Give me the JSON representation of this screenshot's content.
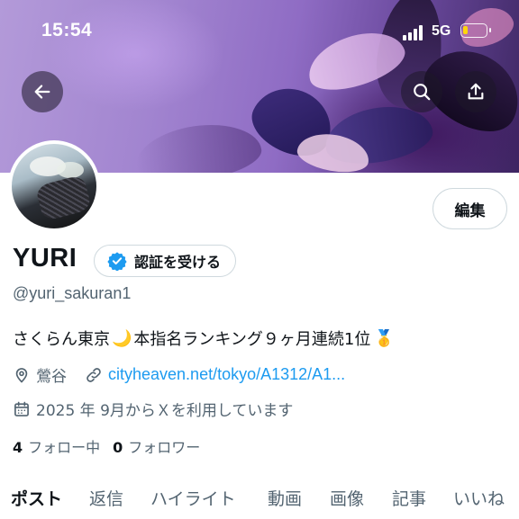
{
  "status_bar": {
    "time": "15:54",
    "network": "5G",
    "battery_level": 0.15,
    "battery_color": "#ffd60a"
  },
  "header": {
    "back_icon": "arrow-left-icon",
    "search_icon": "search-icon",
    "share_icon": "share-icon"
  },
  "profile": {
    "edit_label": "編集",
    "name": "YURI",
    "verify_label": "認証を受ける",
    "verify_icon": "verified-badge-icon",
    "verify_color": "#1d9bf0",
    "handle": "@yuri_sakuran1",
    "bio_part1": "さくらん東京",
    "bio_moon": "🌙",
    "bio_part2": " 本指名ランキング９ヶ月連続1位",
    "bio_medal": "🥇",
    "location": "鶯谷",
    "link": "cityheaven.net/tokyo/A1312/A1...",
    "joined": "2025 年 9月からＸを利用しています",
    "following_count": "4",
    "following_label": "フォロー中",
    "followers_count": "0",
    "followers_label": "フォロワー"
  },
  "tabs": [
    {
      "label": "ポスト",
      "active": true
    },
    {
      "label": "返信",
      "active": false
    },
    {
      "label": "ハイライト",
      "active": false
    },
    {
      "label": "動画",
      "active": false
    },
    {
      "label": "画像",
      "active": false
    },
    {
      "label": "記事",
      "active": false
    },
    {
      "label": "いいね",
      "active": false
    }
  ],
  "colors": {
    "text_primary": "#0f1419",
    "text_secondary": "#536471",
    "link": "#1d9bf0",
    "border": "#cfd9de"
  }
}
